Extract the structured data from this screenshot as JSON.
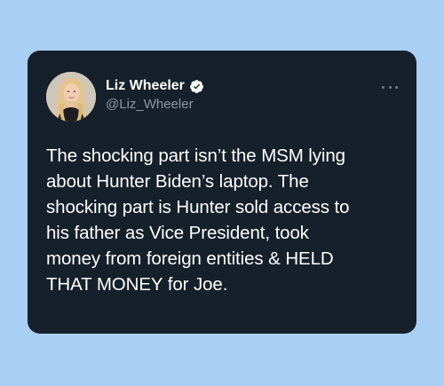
{
  "tweet": {
    "author": {
      "display_name": "Liz Wheeler",
      "handle": "@Liz_Wheeler",
      "verified": true,
      "avatar_icon": "profile-photo"
    },
    "more_icon": "more-horizontal-icon",
    "text_lines": [
      "The shocking part isn’t the MSM lying",
      "about Hunter Biden’s laptop. The",
      "shocking part is Hunter sold access to",
      "his father as Vice President, took",
      "money from foreign entities & HELD",
      "THAT MONEY for Joe."
    ]
  },
  "colors": {
    "page_background": "#a9cff5",
    "card_background": "#15202b",
    "text_primary": "#ffffff",
    "text_secondary": "#8b98a5"
  }
}
